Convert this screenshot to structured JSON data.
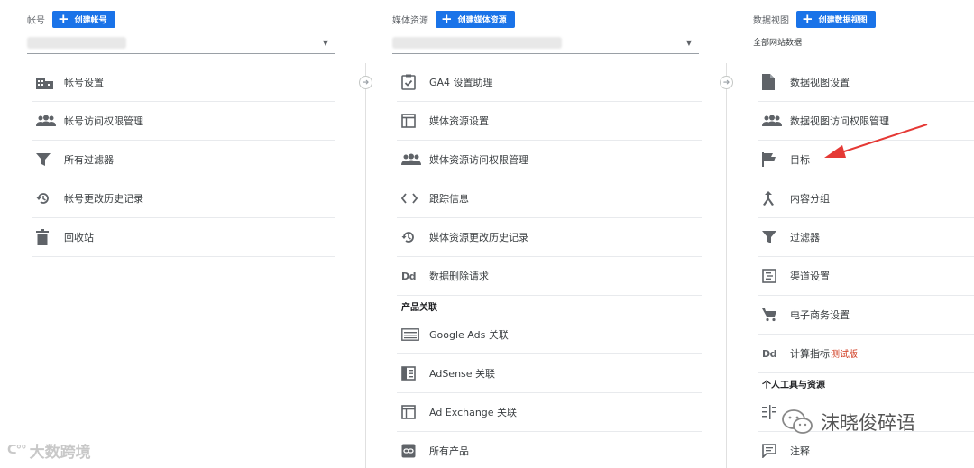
{
  "account": {
    "label": "帐号",
    "create_label": "创建帐号",
    "items": [
      {
        "label": "帐号设置",
        "icon": "building-icon"
      },
      {
        "label": "帐号访问权限管理",
        "icon": "people-icon"
      },
      {
        "label": "所有过滤器",
        "icon": "filter-icon"
      },
      {
        "label": "帐号更改历史记录",
        "icon": "history-icon"
      },
      {
        "label": "回收站",
        "icon": "trash-icon"
      }
    ]
  },
  "property": {
    "label": "媒体资源",
    "create_label": "创建媒体资源",
    "items": [
      {
        "label": "GA4 设置助理",
        "icon": "checklist-icon"
      },
      {
        "label": "媒体资源设置",
        "icon": "window-icon"
      },
      {
        "label": "媒体资源访问权限管理",
        "icon": "people-icon"
      },
      {
        "label": "跟踪信息",
        "icon": "code-icon"
      },
      {
        "label": "媒体资源更改历史记录",
        "icon": "history-icon"
      },
      {
        "label": "数据删除请求",
        "icon": "dd-icon"
      }
    ],
    "section_label": "产品关联",
    "links": [
      {
        "label": "Google Ads 关联",
        "icon": "ads-icon"
      },
      {
        "label": "AdSense 关联",
        "icon": "adsense-icon"
      },
      {
        "label": "Ad Exchange 关联",
        "icon": "adexchange-icon"
      },
      {
        "label": "所有产品",
        "icon": "link-icon"
      }
    ]
  },
  "view": {
    "label": "数据视图",
    "create_label": "创建数据视图",
    "selected": "全部网站数据",
    "items": [
      {
        "label": "数据视图设置",
        "icon": "document-icon"
      },
      {
        "label": "数据视图访问权限管理",
        "icon": "people-icon"
      },
      {
        "label": "目标",
        "icon": "flag-icon"
      },
      {
        "label": "内容分组",
        "icon": "grouping-icon"
      },
      {
        "label": "过滤器",
        "icon": "filter-icon"
      },
      {
        "label": "渠道设置",
        "icon": "channel-icon"
      },
      {
        "label": "电子商务设置",
        "icon": "cart-icon"
      },
      {
        "label": "计算指标",
        "beta": "测试版",
        "icon": "dd-icon"
      }
    ],
    "section_label": "个人工具与资源",
    "tools": [
      {
        "label": "",
        "icon": "segments-icon"
      },
      {
        "label": "注释",
        "icon": "comment-icon"
      }
    ]
  },
  "watermarks": {
    "left": "大数跨境",
    "right": "沫晓俊碎语"
  }
}
